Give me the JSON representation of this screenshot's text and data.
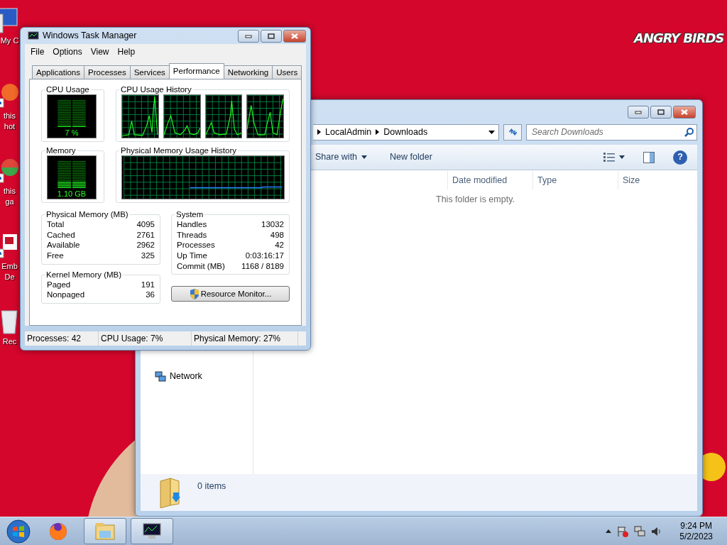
{
  "desktop": {
    "logo": "ANGRY BIRDS",
    "icons": [
      {
        "kind": "computer",
        "lines": [
          "My C"
        ]
      },
      {
        "kind": "shortcut-orange",
        "lines": [
          "this",
          "hot"
        ]
      },
      {
        "kind": "shortcut-green",
        "lines": [
          "this",
          "ga"
        ]
      },
      {
        "kind": "shortcut-doc",
        "lines": [
          "Emb",
          "De"
        ]
      },
      {
        "kind": "bin",
        "lines": [
          "Rec"
        ]
      }
    ]
  },
  "explorer": {
    "breadcrumb": [
      "LocalAdmin",
      "Downloads"
    ],
    "search": {
      "placeholder": "Search Downloads"
    },
    "toolbar": [
      {
        "label": "Share with",
        "dropdown": true
      },
      {
        "label": "New folder",
        "dropdown": false
      }
    ],
    "help": "?",
    "columns": [
      "Date modified",
      "Type",
      "Size"
    ],
    "empty_message": "This folder is empty.",
    "nav_items": [
      "Network"
    ],
    "status": "0 items"
  },
  "task_manager": {
    "title": "Windows Task Manager",
    "menu": [
      "File",
      "Options",
      "View",
      "Help"
    ],
    "tabs": [
      {
        "label": "Applications",
        "selected": false
      },
      {
        "label": "Processes",
        "selected": false
      },
      {
        "label": "Services",
        "selected": false
      },
      {
        "label": "Performance",
        "selected": true
      },
      {
        "label": "Networking",
        "selected": false
      },
      {
        "label": "Users",
        "selected": false
      }
    ],
    "cpu": {
      "label": "CPU Usage",
      "reading": "7 %",
      "level": 0.07
    },
    "cpu_history": {
      "label": "CPU Usage History"
    },
    "memory": {
      "label": "Memory",
      "reading": "1.10 GB",
      "level": 0.27
    },
    "memory_history": {
      "label": "Physical Memory Usage History"
    },
    "groups": [
      {
        "title": "Physical Memory (MB)",
        "rows": [
          [
            "Total",
            "4095"
          ],
          [
            "Cached",
            "2761"
          ],
          [
            "Available",
            "2962"
          ],
          [
            "Free",
            "325"
          ]
        ]
      },
      {
        "title": "Kernel Memory (MB)",
        "rows": [
          [
            "Paged",
            "191"
          ],
          [
            "Nonpaged",
            "36"
          ]
        ]
      },
      {
        "title": "System",
        "rows": [
          [
            "Handles",
            "13032"
          ],
          [
            "Threads",
            "498"
          ],
          [
            "Processes",
            "42"
          ],
          [
            "Up Time",
            "0:03:16:17"
          ],
          [
            "Commit (MB)",
            "1168 / 8189"
          ]
        ]
      }
    ],
    "resource_button": "Resource Monitor...",
    "status_bar": [
      "Processes: 42",
      "CPU Usage: 7%",
      "Physical Memory: 27%"
    ]
  },
  "taskbar": {
    "apps": [
      {
        "kind": "firefox",
        "open": false
      },
      {
        "kind": "explorer",
        "open": true
      },
      {
        "kind": "taskmgr",
        "open": true
      }
    ],
    "clock": {
      "time": "9:24 PM",
      "date": "5/2/2023"
    }
  }
}
